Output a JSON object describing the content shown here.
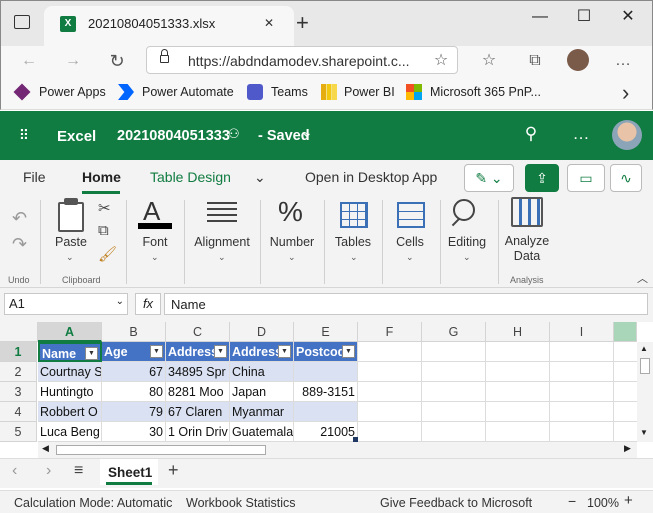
{
  "browser": {
    "tab_title": "20210804051333.xlsx",
    "url": "https://abdndamodev.sharepoint.c...",
    "bookmarks": [
      {
        "label": "Power Apps",
        "color": "#742774"
      },
      {
        "label": "Power Automate",
        "color": "#0066ff"
      },
      {
        "label": "Teams",
        "color": "#5059c9"
      },
      {
        "label": "Power BI",
        "color": "#f2c811"
      },
      {
        "label": "Microsoft 365 PnP...",
        "color": "#f25022"
      }
    ],
    "win_controls": {
      "minimize": "—",
      "maximize": "☐",
      "close": "✕"
    },
    "new_tab": "+",
    "tab_close": "✕",
    "nav": {
      "back": "←",
      "forward": "→",
      "refresh": "↻",
      "more": "…"
    },
    "bookmark_more": "›"
  },
  "excel": {
    "app_name": "Excel",
    "file_name": "20210804051333",
    "saved_status": "- Saved",
    "saved_chevron": "⌄",
    "accent": "#107c41"
  },
  "ribbon": {
    "tabs": [
      "File",
      "Home",
      "Table Design",
      "Open in Desktop App"
    ],
    "active_tab": "Home",
    "commands": {
      "paste": "Paste",
      "font": "Font",
      "alignment": "Alignment",
      "number": "Number",
      "tables": "Tables",
      "cells": "Cells",
      "editing": "Editing",
      "analyze": "Analyze",
      "analyze_2": "Data"
    },
    "groups": {
      "undo": "Undo",
      "clipboard": "Clipboard",
      "analysis": "Analysis"
    },
    "number_icon": "%",
    "font_icon": "A"
  },
  "formula_bar": {
    "name_box": "A1",
    "fx": "fx",
    "content": "Name"
  },
  "grid": {
    "columns": [
      "A",
      "B",
      "C",
      "D",
      "E",
      "F",
      "G",
      "H",
      "I"
    ],
    "rows": [
      "1",
      "2",
      "3",
      "4",
      "5"
    ],
    "headers": [
      "Name",
      "Age",
      "Address",
      "Address",
      "Postcode"
    ],
    "data": [
      [
        "Courtnay S",
        "67",
        "34895 Spr",
        "China",
        ""
      ],
      [
        "Huntingto",
        "80",
        "8281 Moo",
        "Japan",
        "889-3151"
      ],
      [
        "Robbert O",
        "79",
        "67 Claren",
        "Myanmar",
        ""
      ],
      [
        "Luca Beng",
        "30",
        "1 Orin Driv",
        "Guatemala",
        "21005"
      ]
    ],
    "header_color": "#4472c4",
    "band_color": "#d9e1f2"
  },
  "sheets": {
    "active": "Sheet1",
    "add": "+",
    "prev": "‹",
    "next": "›",
    "menu": "≡"
  },
  "status_bar": {
    "calc_mode": "Calculation Mode: Automatic",
    "workbook_stats": "Workbook Statistics",
    "feedback": "Give Feedback to Microsoft",
    "zoom": "100%",
    "zoom_out": "−",
    "zoom_in": "+"
  }
}
